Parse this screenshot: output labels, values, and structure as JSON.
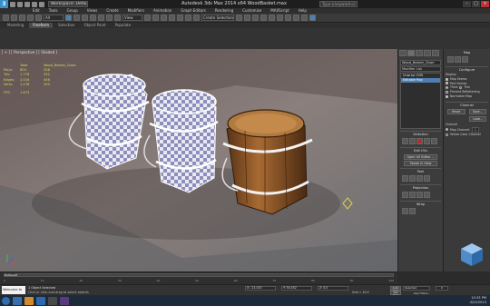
{
  "window": {
    "title": "Autodesk 3ds Max  2014 x64     WoodBasket.max",
    "workspace": "Workspace: Default",
    "search_placeholder": "Type a keyword or phrase",
    "min": "–",
    "max": "□",
    "close": "×"
  },
  "menu": [
    "Edit",
    "Tools",
    "Group",
    "Views",
    "Create",
    "Modifiers",
    "Animation",
    "Graph Editors",
    "Rendering",
    "Customize",
    "MAXScript",
    "Help"
  ],
  "toolbar": {
    "selection_set": "All",
    "view": "View",
    "named_sel": "Create Selection Se"
  },
  "ribbon": {
    "tabs": [
      "Modeling",
      "Freeform",
      "Selection",
      "Object Paint",
      "Populate"
    ],
    "active": 1
  },
  "viewport": {
    "label": "[ + ] [ Perspective ] [ Shaded ]",
    "stats_header": [
      "Total",
      "Wood_Basket_Close"
    ],
    "stats": [
      {
        "k": "Polys:",
        "a": "804",
        "b": "208"
      },
      {
        "k": "Tris:",
        "a": "1,776",
        "b": "352"
      },
      {
        "k": "Edges:",
        "a": "2,016",
        "b": "456"
      },
      {
        "k": "Verts:",
        "a": "1,178",
        "b": "200"
      }
    ],
    "fps_label": "FPS:",
    "fps": "1.673"
  },
  "command_panel": {
    "object_name": "Wood_Basket_Close",
    "modifier_list": "Modifier List",
    "stack": [
      "Editable Poly",
      "Unwrap UVW"
    ],
    "stack_selected": 0,
    "sections": {
      "selection": "Selection",
      "edit_uvs": "Edit UVs",
      "open_uv_editor": "Open UV Editor ...",
      "tweak_in_view": "Tweak In View",
      "peel": "Peel",
      "projection": "Projection",
      "wrap": "Wrap",
      "channel": "Channel",
      "map_channel": "Map Channel:",
      "channel_value": "1"
    }
  },
  "right_panel": {
    "map": "Map",
    "configure": "Configure",
    "display_label": "Display",
    "options": [
      "Map Seams",
      "Peel Seams"
    ],
    "thick": "Thick",
    "thin": "Thin",
    "prevent_reflattening": "Prevent Reflattening",
    "normalize_map": "Normalize Map",
    "channel": "Channel",
    "reset_uvws": "Reset UVWs",
    "save": "Save...",
    "load": "Load...",
    "map_channel": "Map Channel:",
    "map_channel_value": "1",
    "vertex_color_channel": "Vertex Color Channel"
  },
  "timeline": {
    "current": "0 / 100",
    "ticks": [
      "0",
      "10",
      "20",
      "30",
      "40",
      "50",
      "60",
      "70",
      "80",
      "90",
      "100"
    ]
  },
  "status": {
    "maxscript": "Welcome to M",
    "selection": "1 Object Selected",
    "prompt": "Click or click-and-drag to select objects",
    "x": "X: -21.015",
    "y": "Y: 50.452",
    "z": "Z: 0.0",
    "grid": "Grid = 10.0",
    "auto_key": "Auto Key",
    "set_key": "Set Key",
    "selected": "Selected",
    "key_filters": "Key Filters...",
    "frame": "0",
    "add_time_tag": "Add Time Tag"
  },
  "taskbar": {
    "time": "10:33 PM",
    "date": "4/24/2013"
  }
}
